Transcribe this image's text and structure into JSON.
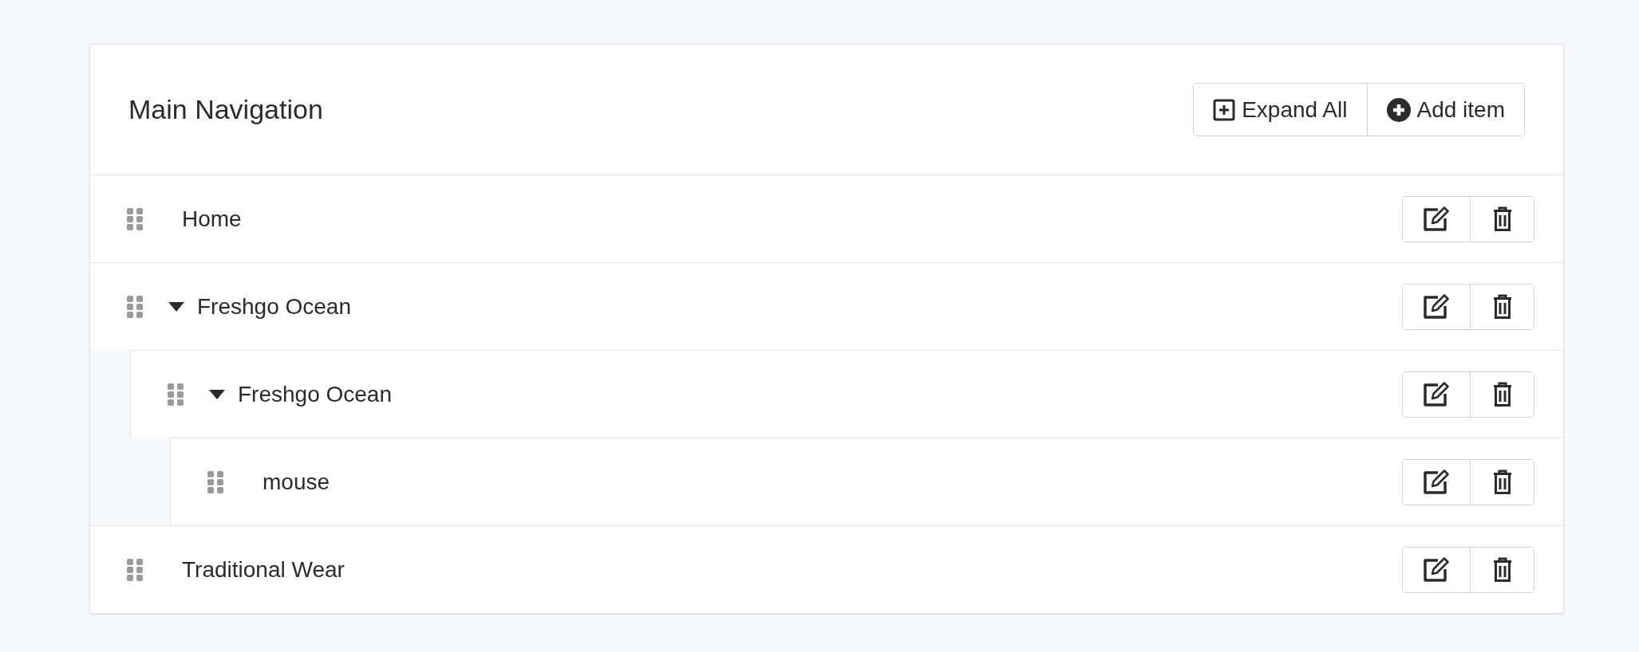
{
  "menu": {
    "title": "Main Navigation",
    "actions": [
      {
        "kind": "expand",
        "label": "Expand All"
      },
      {
        "kind": "add",
        "label": "Add item"
      }
    ],
    "items": [
      {
        "label": "Home"
      },
      {
        "label": "Freshgo Ocean",
        "expanded": true,
        "children": [
          {
            "label": "Freshgo Ocean",
            "expanded": true,
            "children": [
              {
                "label": "mouse"
              }
            ]
          }
        ]
      },
      {
        "label": "Traditional Wear"
      }
    ]
  }
}
